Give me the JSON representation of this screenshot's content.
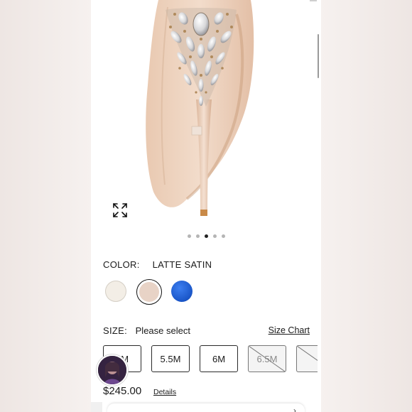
{
  "product": {
    "image_alt": "Latte satin embellished peep-toe pump, back view",
    "carousel": {
      "count": 5,
      "active_index": 2
    }
  },
  "color": {
    "label": "COLOR:",
    "selected_name": "LATTE SATIN",
    "swatches": [
      {
        "name": "ivory",
        "hex": "#f3eee6"
      },
      {
        "name": "latte",
        "hex": "#e8d3c6"
      },
      {
        "name": "blue",
        "hex": "#1f62d6"
      }
    ],
    "selected_index": 1
  },
  "size": {
    "label": "SIZE:",
    "hint": "Please select",
    "chart_link": "Size Chart",
    "options": [
      {
        "label": "5M",
        "available": true
      },
      {
        "label": "5.5M",
        "available": true
      },
      {
        "label": "6M",
        "available": true
      },
      {
        "label": "6.5M",
        "available": false
      },
      {
        "label": "",
        "available": false
      }
    ]
  },
  "price": "$245.00",
  "details_link": "Details",
  "colors": {
    "satin": "#e7c8b2",
    "text": "#1a1a1a"
  },
  "icons": {
    "expand": "expand-arrows-icon",
    "avatar": "user-avatar",
    "bottom": "chevron-right-icon"
  }
}
